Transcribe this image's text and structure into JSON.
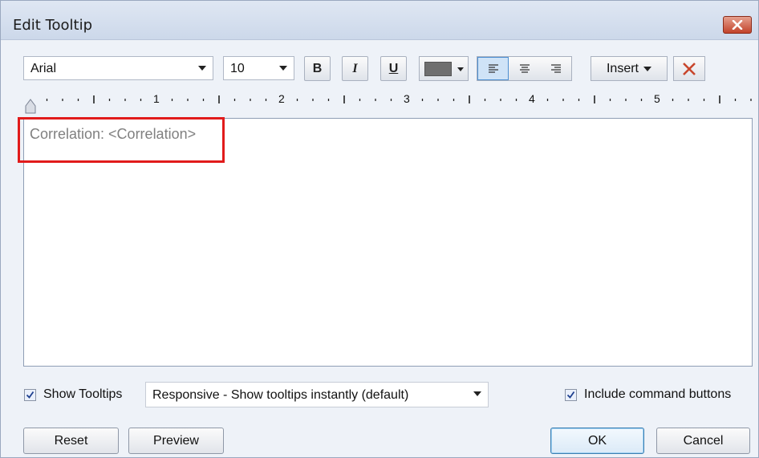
{
  "window": {
    "title": "Edit Tooltip"
  },
  "toolbar": {
    "font_family": "Arial",
    "font_size": "10",
    "bold_label": "B",
    "italic_label": "I",
    "underline_label": "U",
    "text_color": "#6f6f6f",
    "insert_label": "Insert",
    "alignment_selected": "left"
  },
  "ruler": {
    "labels": [
      "1",
      "2",
      "3",
      "4",
      "5"
    ]
  },
  "editor": {
    "content": "Correlation: <Correlation>"
  },
  "footer": {
    "show_tooltips_label": "Show Tooltips",
    "show_tooltips_checked": true,
    "tooltip_mode": "Responsive - Show tooltips instantly (default)",
    "include_buttons_label": "Include command buttons",
    "include_buttons_checked": true
  },
  "buttons": {
    "reset": "Reset",
    "preview": "Preview",
    "ok": "OK",
    "cancel": "Cancel"
  },
  "colors": {
    "highlight_box": "#e11b1b",
    "accent": "#4d8fd1"
  }
}
